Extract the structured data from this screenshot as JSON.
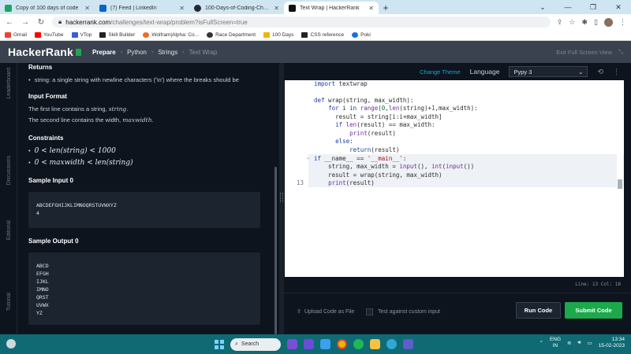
{
  "browser": {
    "tabs": [
      {
        "title": "Copy of 100 days of code",
        "color": "#1ea362",
        "active": false
      },
      {
        "title": "(7) Feed | LinkedIn",
        "color": "#0a66c2",
        "active": false
      },
      {
        "title": "100-Days-of-Coding-Challenge/...",
        "color": "#24292f",
        "active": false
      },
      {
        "title": "Text Wrap | HackerRank",
        "color": "#111111",
        "active": true
      }
    ],
    "new_tab": "+",
    "url_host": "hackerrank.com",
    "url_path": "/challenges/text-wrap/problem?isFullScreen=true",
    "bookmarks": [
      {
        "label": "Gmail",
        "color": "#ea4335"
      },
      {
        "label": "YouTube",
        "color": "#ff0000"
      },
      {
        "label": "VTop",
        "color": "#3b5bdb"
      },
      {
        "label": "Skill Builder",
        "color": "#222222"
      },
      {
        "label": "Wolfram|Alpha: Co...",
        "color": "#f26a22"
      },
      {
        "label": "Race Department",
        "color": "#333333"
      },
      {
        "label": "100 Days",
        "color": "#f4b400"
      },
      {
        "label": "CSS reference",
        "color": "#222222"
      },
      {
        "label": "Poki",
        "color": "#1d6fdc"
      }
    ]
  },
  "header": {
    "logo": "HackerRank",
    "breadcrumbs": [
      "Prepare",
      "Python",
      "Strings",
      "Text Wrap"
    ],
    "exit_fullscreen": "Exit Full Screen View"
  },
  "left_tabs": [
    "Leaderboard",
    "Discussions",
    "Editorial",
    "Tutorial"
  ],
  "problem": {
    "returns_heading": "Returns",
    "returns_bullet": "string: a single string with newline characters ('\\n') where the breaks should be",
    "input_heading": "Input Format",
    "input_line1_pre": "The first line contains a string, ",
    "input_line1_var": "string",
    "input_line2_pre": "The second line contains the width, ",
    "input_line2_var": "maxwidth",
    "constraints_heading": "Constraints",
    "constraint1": "0 < len(string) < 1000",
    "constraint2": "0 < maxwidth < len(string)",
    "sample_input_heading": "Sample Input 0",
    "sample_input": "ABCDEFGHIJKLIMNOQRSTUVWXYZ\n4",
    "sample_output_heading": "Sample Output 0",
    "sample_output": "ABCD\nEFGH\nIJKL\nIMNO\nQRST\nUVWX\nYZ"
  },
  "editor": {
    "change_theme": "Change Theme",
    "language_label": "Language",
    "language_value": "Pypy 3",
    "active_line_number": "13",
    "status": "Line: 13 Col: 18",
    "upload": "Upload Code as File",
    "custom_input": "Test against custom input",
    "run": "Run Code",
    "submit": "Submit Code"
  },
  "taskbar": {
    "search": "Search",
    "lang_top": "ENG",
    "lang_bottom": "IN",
    "time": "13:34",
    "date": "15-02-2023"
  }
}
